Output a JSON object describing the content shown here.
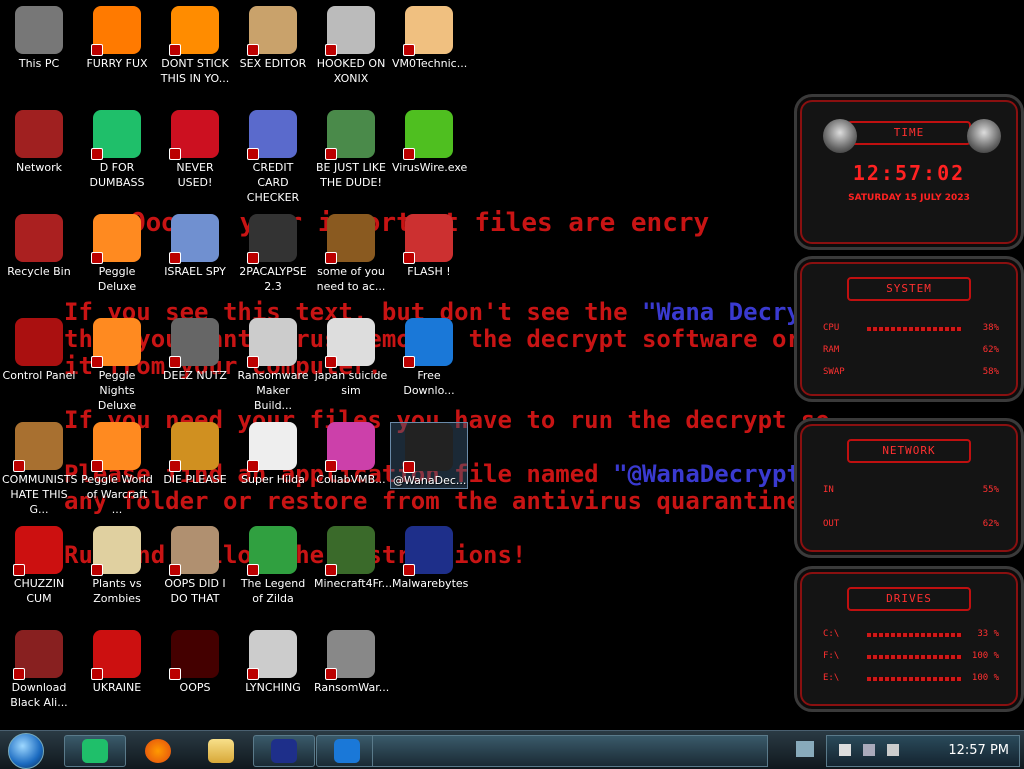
{
  "wallpaper": {
    "line1": "Ooops, your important files are encry",
    "line2a": "If you see this text, but don't see the ",
    "line2b": "\"Wana Decryp",
    "line3": "then your antivirus removed the decrypt software or",
    "line4": "it from your computer.",
    "line5": "If you need your files you have to run the decrypt so",
    "line6a": "Please find an application file named ",
    "line6b": "\"@WanaDecrypto",
    "line7": "any folder or restore from the antivirus quarantine.",
    "line8": "Run and follow the instructions!"
  },
  "icons": [
    {
      "label": "This PC"
    },
    {
      "label": "FURRY FUX"
    },
    {
      "label": "DONT STICK THIS IN YO..."
    },
    {
      "label": "SEX EDITOR"
    },
    {
      "label": "HOOKED ON XONIX"
    },
    {
      "label": "VM0Technic..."
    },
    {
      "label": "Network"
    },
    {
      "label": "D FOR DUMBASS"
    },
    {
      "label": "NEVER USED!"
    },
    {
      "label": "CREDIT CARD CHECKER"
    },
    {
      "label": "BE JUST LIKE THE DUDE!"
    },
    {
      "label": "VirusWire.exe"
    },
    {
      "label": "Recycle Bin"
    },
    {
      "label": "Peggle Deluxe"
    },
    {
      "label": "ISRAEL SPY"
    },
    {
      "label": "2PACALYPSE 2.3"
    },
    {
      "label": "some of you need to ac..."
    },
    {
      "label": "FLASH !"
    },
    {
      "label": "Control Panel"
    },
    {
      "label": "Peggle Nights Deluxe"
    },
    {
      "label": "DEEZ NUTZ"
    },
    {
      "label": "Ransomware Maker Build..."
    },
    {
      "label": "japan suicide sim"
    },
    {
      "label": "Free Downlo..."
    },
    {
      "label": "COMMUNISTS HATE THIS G..."
    },
    {
      "label": "Peggle World of Warcraft ..."
    },
    {
      "label": "DIE PLEASE"
    },
    {
      "label": "Super Hilda"
    },
    {
      "label": "CollabVMB..."
    },
    {
      "label": "@WanaDec..."
    },
    {
      "label": "CHUZZIN CUM"
    },
    {
      "label": "Plants vs Zombies"
    },
    {
      "label": "OOPS DID I DO THAT"
    },
    {
      "label": "The Legend of Zilda"
    },
    {
      "label": "Minecraft4Fr..."
    },
    {
      "label": "Malwarebytes"
    },
    {
      "label": "Download Black Ali..."
    },
    {
      "label": "UKRAINE"
    },
    {
      "label": "OOPS"
    },
    {
      "label": "LYNCHING"
    },
    {
      "label": "RansomWar..."
    }
  ],
  "gadgets": {
    "time_title": "TIME",
    "clock": "12:57:02",
    "date": "SATURDAY 15 JULY 2023",
    "system_title": "SYSTEM",
    "cpu_label": "CPU",
    "cpu_val": "38%",
    "ram_label": "RAM",
    "ram_val": "62%",
    "swap_label": "SWAP",
    "swap_val": "58%",
    "network_title": "NETWORK",
    "in_label": "IN",
    "in_val": "55%",
    "out_label": "OUT",
    "out_val": "62%",
    "drives_title": "DRIVES",
    "c_label": "C:\\",
    "c_val": "33 %",
    "f_label": "F:\\",
    "f_val": "100 %",
    "e_label": "E:\\",
    "e_val": "100 %"
  },
  "taskbar": {
    "time": "12:57 PM"
  },
  "colors": {
    "ransom_red": "#c81414",
    "ransom_blue": "#3a3ad0",
    "gadget_red": "#ff2222"
  }
}
